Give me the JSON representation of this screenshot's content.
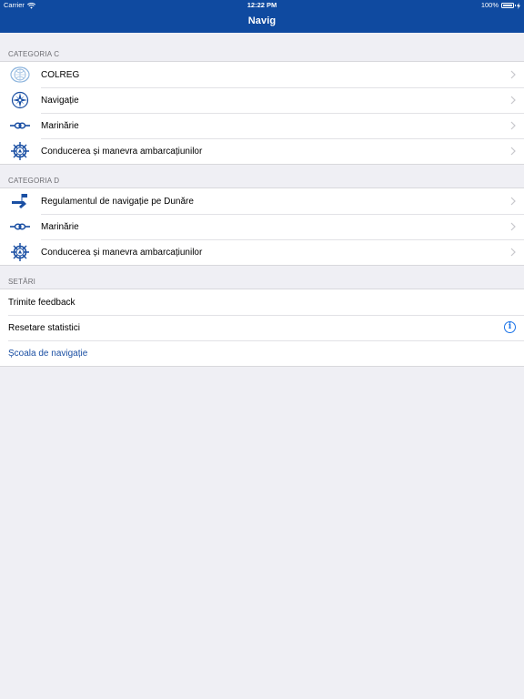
{
  "status_bar": {
    "carrier": "Carrier",
    "time": "12:22 PM",
    "battery": "100%",
    "battery_level": 1.0
  },
  "nav": {
    "title": "Navig"
  },
  "colors": {
    "header": "#0f4aa0",
    "icon_blue": "#1a4fa3",
    "link": "#1a4fa3"
  },
  "sections": {
    "cat_c": {
      "header": "CATEGORIA C",
      "items": [
        {
          "label": "COLREG",
          "icon": "un-emblem-icon"
        },
        {
          "label": "Navigație",
          "icon": "compass-rose-icon"
        },
        {
          "label": "Marinărie",
          "icon": "rope-knot-icon"
        },
        {
          "label": "Conducerea și manevra ambarcațiunilor",
          "icon": "ship-wheel-icon"
        }
      ]
    },
    "cat_d": {
      "header": "CATEGORIA D",
      "items": [
        {
          "label": "Regulamentul de navigație pe Dunăre",
          "icon": "river-flag-icon"
        },
        {
          "label": "Marinărie",
          "icon": "rope-knot-icon"
        },
        {
          "label": "Conducerea și manevra ambarcațiunilor",
          "icon": "ship-wheel-icon"
        }
      ]
    },
    "settings": {
      "header": "SETĂRI",
      "items": [
        {
          "label": "Trimite feedback"
        },
        {
          "label": "Resetare statistici",
          "icon": "info-icon"
        },
        {
          "label": "Școala de navigație"
        }
      ]
    }
  }
}
